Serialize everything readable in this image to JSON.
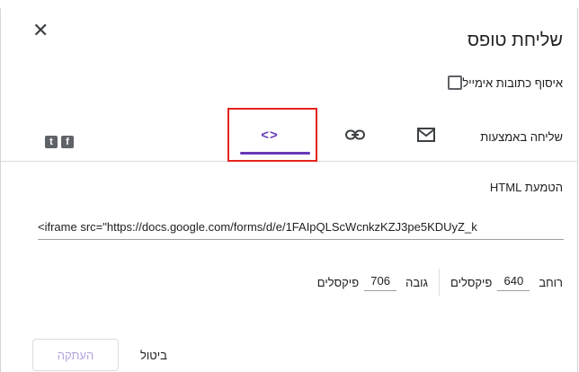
{
  "dialog": {
    "title": "שליחת טופס",
    "close_icon": "close-icon",
    "collect_emails_label": "איסוף כתובות אימייל",
    "collect_emails_checked": false
  },
  "send_via": {
    "label": "שליחה באמצעות",
    "tabs": [
      {
        "name": "email",
        "icon": "envelope-icon"
      },
      {
        "name": "link",
        "icon": "link-icon"
      },
      {
        "name": "embed",
        "icon": "code-icon",
        "glyph": "<>",
        "selected": true
      }
    ],
    "social": [
      {
        "name": "facebook",
        "glyph": "f"
      },
      {
        "name": "twitter",
        "glyph": "t"
      }
    ]
  },
  "embed": {
    "section_title": "הטמעת HTML",
    "code": "<iframe src=\"https://docs.google.com/forms/d/e/1FAIpQLScWcnkzKZJ3pe5KDUyZ_k",
    "width_label": "רוחב",
    "width_value": "640",
    "width_unit": "פיקסלים",
    "height_label": "גובה",
    "height_value": "706",
    "height_unit": "פיקסלים"
  },
  "footer": {
    "copy_label": "העתקה",
    "cancel_label": "ביטול"
  },
  "colors": {
    "accent": "#673ab7",
    "highlight_box": "#e5231f",
    "header_strip_text": "#1a56c4"
  }
}
